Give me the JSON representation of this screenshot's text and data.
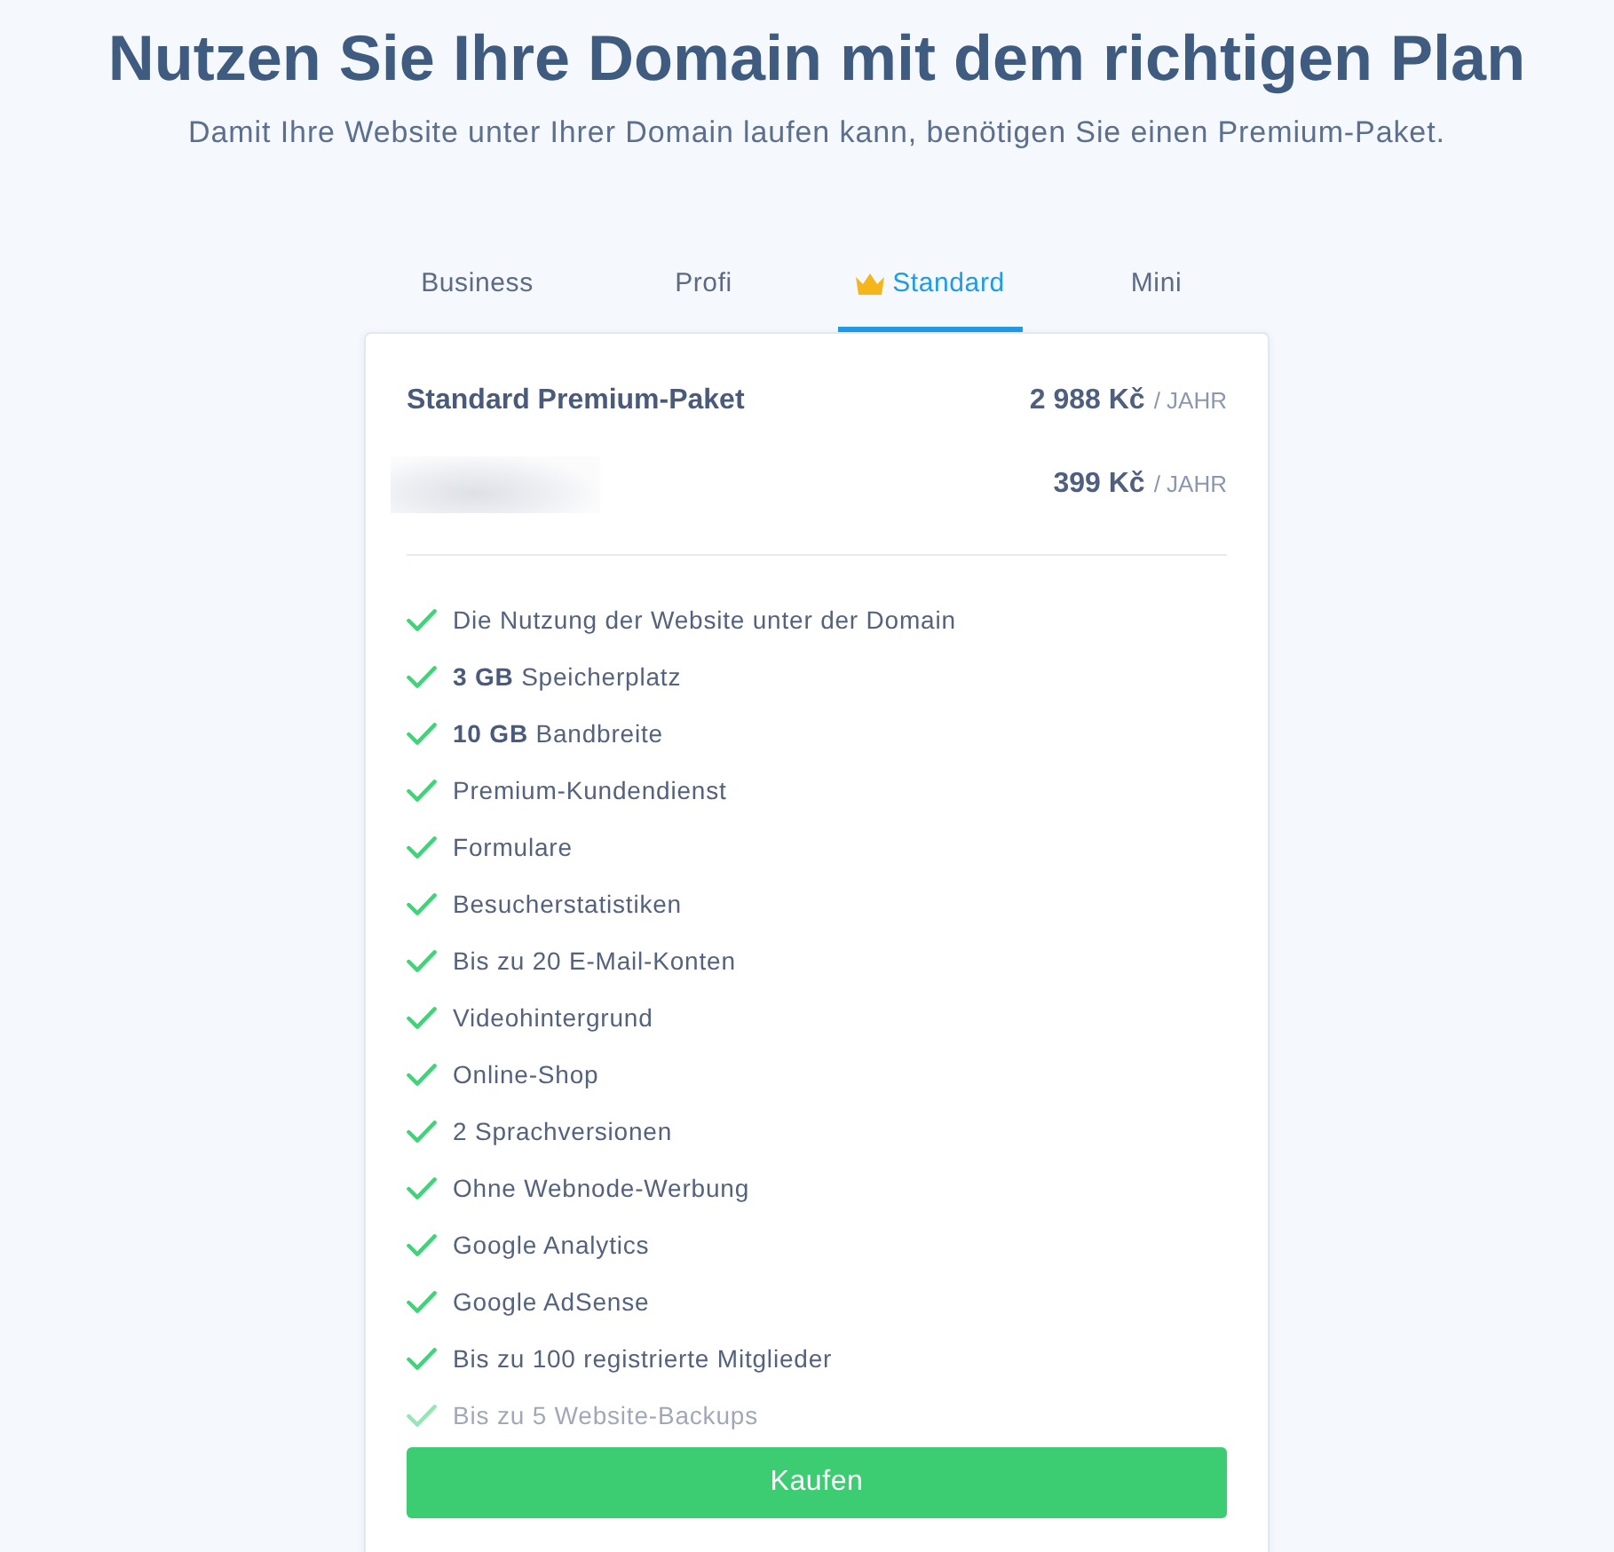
{
  "header": {
    "title": "Nutzen Sie Ihre Domain mit dem richtigen Plan",
    "subtitle": "Damit Ihre Website unter Ihrer Domain laufen kann, benötigen Sie einen Premium-Paket."
  },
  "tabs": [
    {
      "label": "Business",
      "selected": false,
      "crown": false
    },
    {
      "label": "Profi",
      "selected": false,
      "crown": false
    },
    {
      "label": "Standard",
      "selected": true,
      "crown": true
    },
    {
      "label": "Mini",
      "selected": false,
      "crown": false
    }
  ],
  "price_rows": [
    {
      "kind": "title",
      "label": "Standard Premium-Paket",
      "amount": "2 988 Kč",
      "period": "/ JAHR"
    },
    {
      "kind": "blurred",
      "amount": "399 Kč",
      "period": "/ JAHR"
    }
  ],
  "features": [
    {
      "text": "Die Nutzung der Website unter der Domain",
      "faded": false
    },
    {
      "text": "**3 GB** Speicherplatz",
      "faded": false
    },
    {
      "text": "**10 GB** Bandbreite",
      "faded": false
    },
    {
      "text": "Premium-Kundendienst",
      "faded": false
    },
    {
      "text": "Formulare",
      "faded": false
    },
    {
      "text": "Besucherstatistiken",
      "faded": false
    },
    {
      "text": "Bis zu 20 E-Mail-Konten",
      "faded": false
    },
    {
      "text": "Videohintergrund",
      "faded": false
    },
    {
      "text": "Online-Shop",
      "faded": false
    },
    {
      "text": "2 Sprachversionen",
      "faded": false
    },
    {
      "text": "Ohne Webnode-Werbung",
      "faded": false
    },
    {
      "text": "Google Analytics",
      "faded": false
    },
    {
      "text": "Google AdSense",
      "faded": false
    },
    {
      "text": "Bis zu 100 registrierte Mitglieder",
      "faded": false
    },
    {
      "text": "Bis zu 5 Website-Backups",
      "faded": true
    }
  ],
  "buy_button": {
    "label": "Kaufen"
  }
}
